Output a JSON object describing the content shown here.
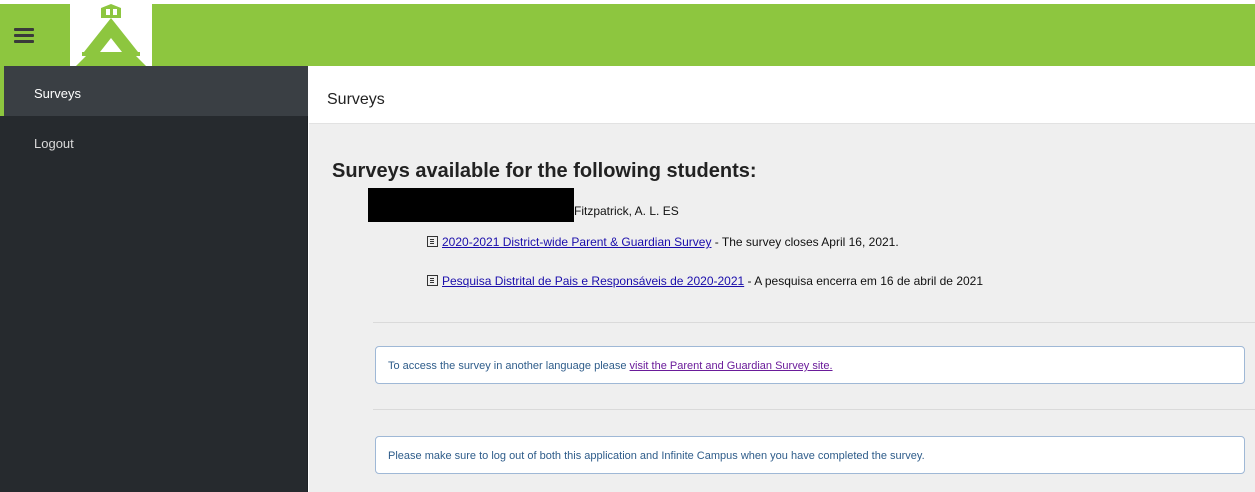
{
  "header": {
    "menu_icon": "hamburger-menu-icon",
    "logo_icon": "school-building-logo",
    "brand_color": "#8dc63f"
  },
  "sidebar": {
    "items": [
      {
        "label": "Surveys",
        "active": true
      },
      {
        "label": "Logout",
        "active": false
      }
    ]
  },
  "page": {
    "title": "Surveys",
    "heading": "Surveys available for the following students:"
  },
  "student": {
    "name": "Fitzpatrick, A. L. ES",
    "surveys": [
      {
        "link_text": "2020-2021 District-wide Parent & Guardian Survey",
        "suffix": " - The survey closes April 16, 2021.",
        "icon": "document-icon"
      },
      {
        "link_text": "Pesquisa Distrital de Pais e Responsáveis de 2020-2021",
        "suffix": " - A pesquisa encerra em 16 de abril de 2021",
        "icon": "document-icon"
      }
    ]
  },
  "notices": {
    "language_prefix": "To access the survey in another language please ",
    "language_link": "visit the Parent and Guardian Survey site.",
    "logout_text": "Please make sure to log out of both this application and Infinite Campus when you have completed the survey."
  }
}
